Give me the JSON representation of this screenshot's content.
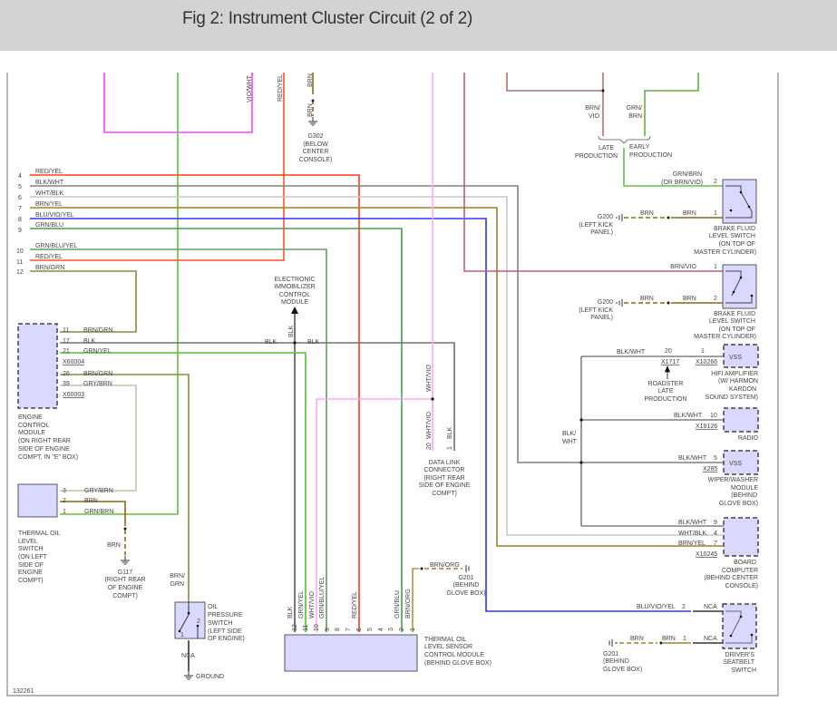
{
  "header": {
    "title": "Fig 2: Instrument Cluster Circuit (2 of 2)"
  },
  "figure_id": "132261",
  "colors": {
    "header_bg": "#d3d3d3",
    "module_fill": "#d9d9ff",
    "red_yel": "#ff4020",
    "blk_wht": "#808080",
    "wht_blk": "#c8c8c8",
    "brn_yel": "#a08020",
    "blu_vio_yel": "#3030ff",
    "grn_blu": "#40a050",
    "grn_blu_yel": "#60a060",
    "brn_grn": "#8a8a40",
    "vio_wht": "#ff40ff",
    "wht_vio": "#ffa8f0",
    "brn": "#8b6914",
    "brn_vio": "#b06080",
    "green": "#50c030",
    "blk": "#707070"
  },
  "left_connector": {
    "pins": [
      "4",
      "5",
      "6",
      "7",
      "8",
      "9",
      "10",
      "11",
      "12"
    ],
    "wires": [
      "RED/YEL",
      "BLK/WHT",
      "WHT/BLK",
      "BRN/YEL",
      "BLU/VIO/YEL",
      "GRN/BLU",
      "GRN/BLU/YEL",
      "RED/YEL",
      "BRN/GRN"
    ]
  },
  "top_wires": {
    "vio_wht": "VIO/WHT",
    "red_yel": "RED/YEL",
    "brn_upper": "BRN",
    "brn_lower": "BRN"
  },
  "g302": {
    "lines": [
      "G302",
      "(BELOW",
      "CENTER",
      "CONSOLE)"
    ]
  },
  "production": {
    "brn_vio": [
      "BRN/",
      "VIO"
    ],
    "grn_brn": [
      "GRN/",
      "BRN"
    ],
    "late": [
      "LATE",
      "PRODUCTION"
    ],
    "early": [
      "EARLY",
      "PRODUCTION"
    ]
  },
  "brake_switch_1": {
    "wire2": [
      "GRN/BRN",
      "(OR BRN/VIO)"
    ],
    "pin2": "2",
    "pin1": "1",
    "wire_gnd": "BRN",
    "wire1": "BRN",
    "ground": [
      "G200",
      "(LEFT KICK",
      "PANEL)"
    ],
    "name": [
      "BRAKE FLUID",
      "LEVEL SWITCH",
      "(ON TOP OF",
      "MASTER CYLINDER)"
    ]
  },
  "brake_switch_2": {
    "wire1": "BRN/VIO",
    "pin1": "1",
    "pin2": "2",
    "wire_gnd": "BRN",
    "wire2": "BRN",
    "ground": [
      "G200",
      "(LEFT KICK",
      "PANEL)"
    ],
    "name": [
      "BRAKE FLUID",
      "LEVEL SWITCH",
      "(ON TOP OF",
      "MASTER CYLINDER)"
    ]
  },
  "immobilizer": {
    "name": [
      "ELECTRONIC",
      "IMMOBILIZER",
      "CONTROL",
      "MODULE"
    ],
    "wire": "BLK"
  },
  "blk_junction": {
    "left": "BLK",
    "right": "BLK"
  },
  "ecm": {
    "group1": [
      {
        "pin": "11",
        "wire": "BRN/GRN"
      },
      {
        "pin": "17",
        "wire": "BLK"
      },
      {
        "pin": "21",
        "wire": "GRN/YEL"
      }
    ],
    "conn1": "X60004",
    "group2": [
      {
        "pin": "26",
        "wire": "BRN/GRN"
      },
      {
        "pin": "39",
        "wire": "GRY/BRN"
      }
    ],
    "conn2": "X60003",
    "name": [
      "ENGINE",
      "CONTROL",
      "MODULE",
      "(ON RIGHT REAR",
      "SIDE OF ENGINE",
      "COMPT, IN \"E\" BOX)"
    ]
  },
  "dlc": {
    "wht_vio_upper": "WHT/VIO",
    "wht_vio_lower": "WHT/VIO",
    "blk": "BLK",
    "pin20": "20",
    "pin1": "1",
    "name": [
      "DATA LINK",
      "CONNECTOR",
      "(RIGHT REAR",
      "SIDE OF ENGINE",
      "COMPT)"
    ]
  },
  "thermal_switch": {
    "pins": [
      {
        "pin": "3",
        "wire": "GRY/BRN"
      },
      {
        "pin": "2",
        "wire": "BRN"
      },
      {
        "pin": "1",
        "wire": "GRN/BRN"
      }
    ],
    "ground_wire": "BRN",
    "ground": [
      "G117",
      "(RIGHT REAR",
      "OF ENGINE",
      "COMPT)"
    ],
    "name": [
      "THERMAL OIL",
      "LEVEL",
      "SWITCH",
      "(ON LEFT",
      "SIDE OF",
      "ENGINE",
      "COMPT)"
    ]
  },
  "oil_pressure": {
    "wire": [
      "BRN/",
      "GRN"
    ],
    "pin1": "1",
    "pin2": "2",
    "nca": "NCA",
    "ground": "GROUND",
    "name": [
      "OIL",
      "PRESSURE",
      "SWITCH",
      "(LEFT SIDE",
      "OF ENGINE)"
    ]
  },
  "tolscm": {
    "pins": [
      "12",
      "11",
      "10",
      "9",
      "8",
      "7",
      "6",
      "5",
      "4",
      "3",
      "2",
      "1"
    ],
    "wires": {
      "p12": "BLK",
      "p11": "GRN/YEL",
      "p10": "WHT/VIO",
      "p9": "GRN/BLU/YEL",
      "p6": "RED/YEL",
      "p2": "GRN/BLU",
      "p1": "BRN/ORG"
    },
    "name": [
      "THERMAL OIL",
      "LEVEL SENSOR",
      "CONTROL MODULE",
      "(BEHIND GLOVE BOX)"
    ],
    "ground_wire": "BRN/ORG",
    "ground": [
      "G201",
      "(BEHIND",
      "GLOVE BOX)"
    ]
  },
  "hifi": {
    "wire": "BLK/WHT",
    "pin_inline": "20",
    "conn_inline": "X1717",
    "pin": "1",
    "conn": "X10266",
    "label": "VSS",
    "note": [
      "ROADSTER",
      "LATE",
      "PRODUCTION"
    ],
    "name": [
      "HIFI AMPLIFIER",
      "(W/ HARMON",
      "KARDON",
      "SOUND SYSTEM)"
    ]
  },
  "bus_label": [
    "BLK/",
    "WHT"
  ],
  "radio": {
    "wire": "BLK/WHT",
    "pin": "10",
    "conn": "X18126",
    "name": "RADIO"
  },
  "wiper": {
    "wire": "BLK/WHT",
    "pin": "5",
    "conn": "X285",
    "label": "VSS",
    "name": [
      "WIPER/WASHER",
      "MODULE",
      "(BEHIND",
      "GLOVE BOX)"
    ]
  },
  "board_computer": {
    "pins": [
      {
        "pin": "9",
        "wire": "BLK/WHT"
      },
      {
        "pin": "4",
        "wire": "WHT/BLK"
      },
      {
        "pin": "7",
        "wire": "BRN/YEL"
      }
    ],
    "conn": "X10245",
    "name": [
      "BOARD",
      "COMPUTER",
      "(BEHIND CENTER",
      "CONSOLE)"
    ]
  },
  "seatbelt": {
    "wire2": "BLU/VIO/YEL",
    "pin2": "2",
    "nca2": "NCA",
    "wire_gnd": "BRN",
    "wire1": "BRN",
    "pin1": "1",
    "nca1": "NCA",
    "ground": [
      "G201",
      "(BEHIND",
      "GLOVE BOX)"
    ],
    "name": [
      "DRIVER'S",
      "SEATBELT",
      "SWITCH"
    ]
  }
}
